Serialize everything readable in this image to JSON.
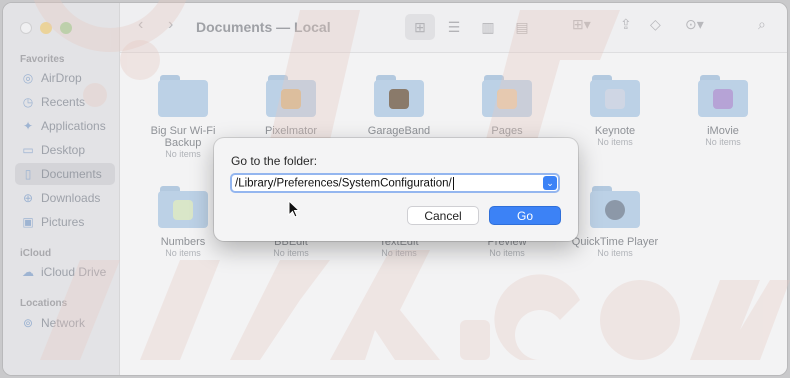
{
  "window": {
    "title": "Documents — Local"
  },
  "sidebar": {
    "sections": [
      {
        "label": "Favorites"
      },
      {
        "label": "iCloud"
      },
      {
        "label": "Locations"
      }
    ],
    "items": [
      {
        "label": "AirDrop",
        "icon": "airdrop-icon"
      },
      {
        "label": "Recents",
        "icon": "clock-icon"
      },
      {
        "label": "Applications",
        "icon": "applications-icon"
      },
      {
        "label": "Desktop",
        "icon": "desktop-icon"
      },
      {
        "label": "Documents",
        "icon": "document-icon",
        "selected": true
      },
      {
        "label": "Downloads",
        "icon": "download-icon"
      },
      {
        "label": "Pictures",
        "icon": "pictures-icon"
      },
      {
        "label": "iCloud Drive",
        "icon": "cloud-icon"
      },
      {
        "label": "Network",
        "icon": "globe-icon"
      }
    ]
  },
  "files": [
    {
      "name": "Big Sur Wi-Fi Backup",
      "name_line1": "Big Sur Wi-Fi",
      "name_line2": "Backup",
      "sub": "No items"
    },
    {
      "name": "Pixelmator",
      "sub": ""
    },
    {
      "name": "GarageBand",
      "sub": ""
    },
    {
      "name": "Pages",
      "sub": ""
    },
    {
      "name": "Keynote",
      "sub": "No items"
    },
    {
      "name": "iMovie",
      "sub": "No items"
    },
    {
      "name": "Numbers",
      "sub": "No items"
    },
    {
      "name": "BBEdit",
      "sub": "No items"
    },
    {
      "name": "TextEdit",
      "sub": "No items"
    },
    {
      "name": "Preview",
      "sub": "No items"
    },
    {
      "name": "QuickTime Player",
      "sub": "No items"
    }
  ],
  "dialog": {
    "title": "Go to the folder:",
    "path_value": "/Library/Preferences/SystemConfiguration/",
    "cancel_label": "Cancel",
    "go_label": "Go"
  },
  "colors": {
    "accent": "#3c82f6",
    "folder": "#bcd1e6",
    "watermark": "#e8cfc8"
  }
}
